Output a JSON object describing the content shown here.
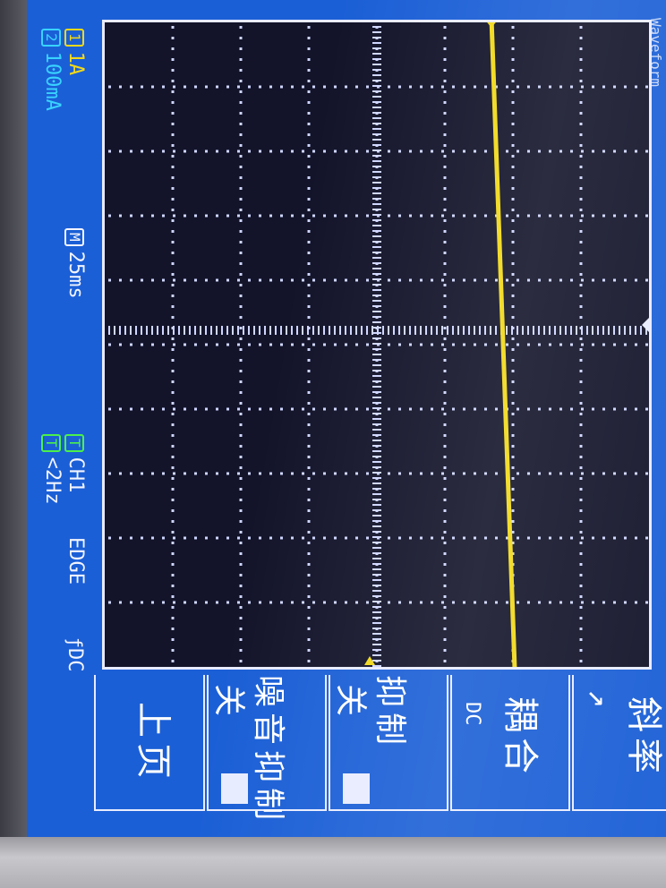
{
  "status": {
    "ch1_scale": "1A",
    "ch2_scale": "100mA",
    "ch1_tag": "1",
    "ch2_tag": "2",
    "timebase_tag": "M",
    "timebase": "25ms",
    "trigger_source_tag": "T",
    "trigger_source": "CH1",
    "trigger_type": "EDGE",
    "trigger_coupling": "DC",
    "freq_tag": "T",
    "frequency": "<2Hz",
    "top_right_text": "Waveform"
  },
  "menu": {
    "items": [
      {
        "label": "上页",
        "sub": ""
      },
      {
        "label": "噪音抑制",
        "sub": "关"
      },
      {
        "label": "抑制",
        "sub": "关"
      },
      {
        "label": "耦合",
        "sub": "DC"
      },
      {
        "label": "斜率",
        "sub": "上升"
      }
    ]
  },
  "colors": {
    "screen_bg": "#1b5fd6",
    "grid_bg": "#13142a",
    "trace": "#f1d91a",
    "ch2": "#38d3ff",
    "status_green": "#4cf04c"
  }
}
